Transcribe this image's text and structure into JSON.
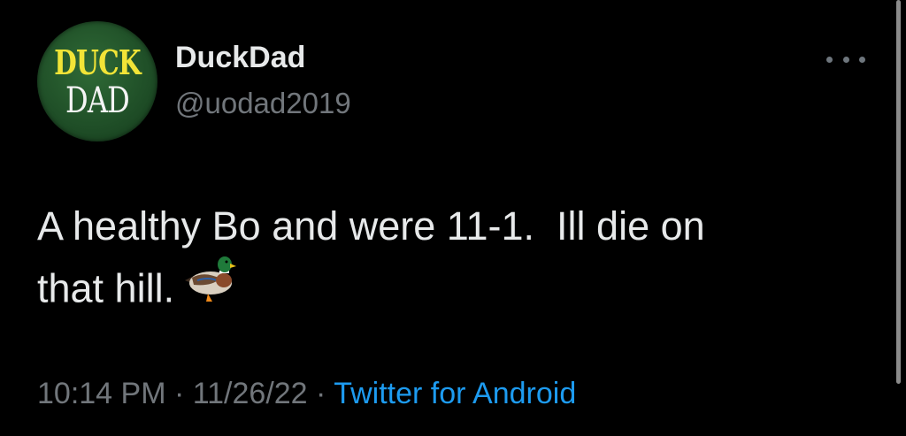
{
  "author": {
    "avatar_text_top": "DUCK",
    "avatar_text_bottom": "DAD",
    "display_name": "DuckDad",
    "handle": "@uodad2019"
  },
  "tweet": {
    "text": "A healthy Bo and were 11-1.  Ill die on\nthat hill.",
    "emoji": "duck-emoji"
  },
  "meta": {
    "time": "10:14 PM",
    "separator": "·",
    "date": "11/26/22",
    "source": "Twitter for Android"
  },
  "colors": {
    "background": "#000000",
    "primary_text": "#e7e9ea",
    "secondary_text": "#71767b",
    "link": "#1d9bf0",
    "avatar_green": "#1f4e27",
    "avatar_yellow": "#f2e437"
  }
}
